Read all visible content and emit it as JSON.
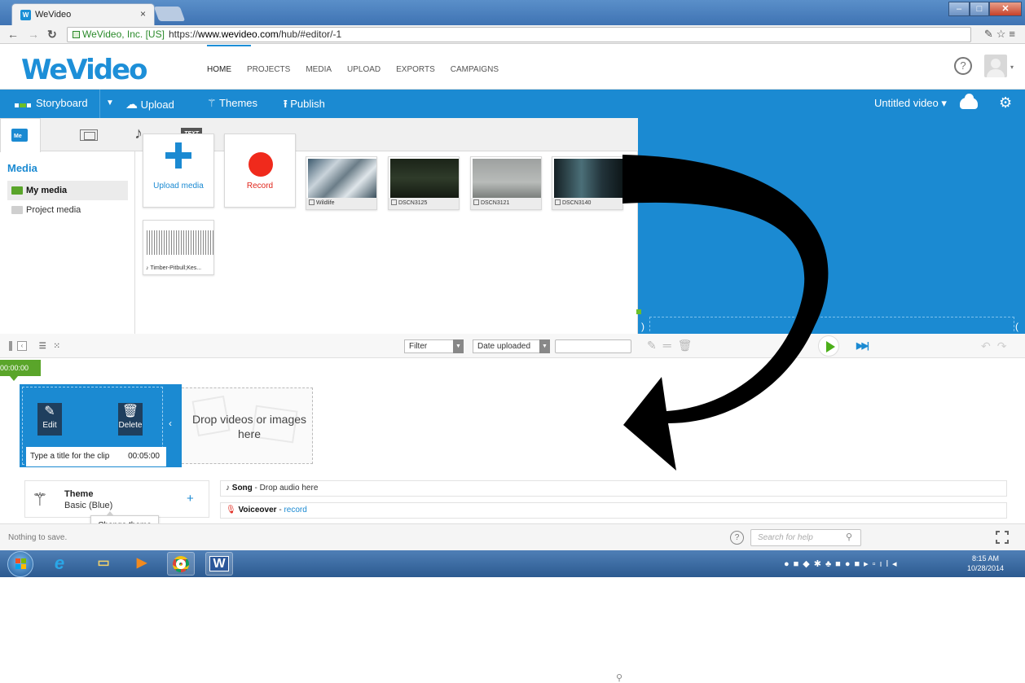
{
  "browser": {
    "tab_title": "WeVideo",
    "tab_close": "×",
    "secure_label": "WeVideo, Inc. [US]",
    "url_scheme": "https://",
    "url_host": "www.wevideo.com",
    "url_path": "/hub/#editor/-1"
  },
  "topnav": {
    "logo_text": "WeVideo",
    "menu": [
      "HOME",
      "PROJECTS",
      "MEDIA",
      "UPLOAD",
      "EXPORTS",
      "CAMPAIGNS"
    ],
    "active_menu": "HOME"
  },
  "toolbar": {
    "storyboard_label": "Storyboard",
    "upload_label": "Upload",
    "themes_label": "Themes",
    "publish_label": "Publish",
    "video_title": "Untitled video ▾",
    "accent_color": "#1b8ad2"
  },
  "media": {
    "tab_text_label": "TEXT",
    "tab_media_label": "Me",
    "heading": "Media",
    "folders": [
      {
        "label": "My media",
        "selected": true,
        "color": "#5aa52a"
      },
      {
        "label": "Project media",
        "selected": false,
        "color": "#cfcfcf"
      }
    ],
    "upload_label": "Upload media",
    "record_label": "Record",
    "items": [
      {
        "name": "Wildlife",
        "icon": "film-icon"
      },
      {
        "name": "DSCN3125",
        "icon": "clip-icon"
      },
      {
        "name": "DSCN3121",
        "icon": "clip-icon"
      },
      {
        "name": "DSCN3140",
        "icon": "clip-icon"
      },
      {
        "name": "Timber-Pitbull;Kes...",
        "icon": "music-note-icon"
      }
    ]
  },
  "filterbar": {
    "filter_label": "Filter",
    "sort_label": "Date uploaded",
    "search_value": ""
  },
  "timeline": {
    "timecode": "00:00:00",
    "clip_edit_label": "Edit",
    "clip_delete_label": "Delete",
    "clip_title_placeholder": "Type a title for the clip",
    "clip_duration": "00:05:00",
    "drop_text": "Drop videos or images here",
    "theme_title": "Theme",
    "theme_value": "Basic (Blue)",
    "theme_tooltip": "Change theme",
    "song_label": "Song",
    "song_hint": " - Drop audio here",
    "voiceover_label": "Voiceover",
    "voiceover_sep": " - ",
    "voiceover_link": "record"
  },
  "statusbar": {
    "status_text": "Nothing to save.",
    "help_search_placeholder": "Search for help"
  },
  "taskbar": {
    "time": "8:15 AM",
    "date": "10/28/2014"
  }
}
